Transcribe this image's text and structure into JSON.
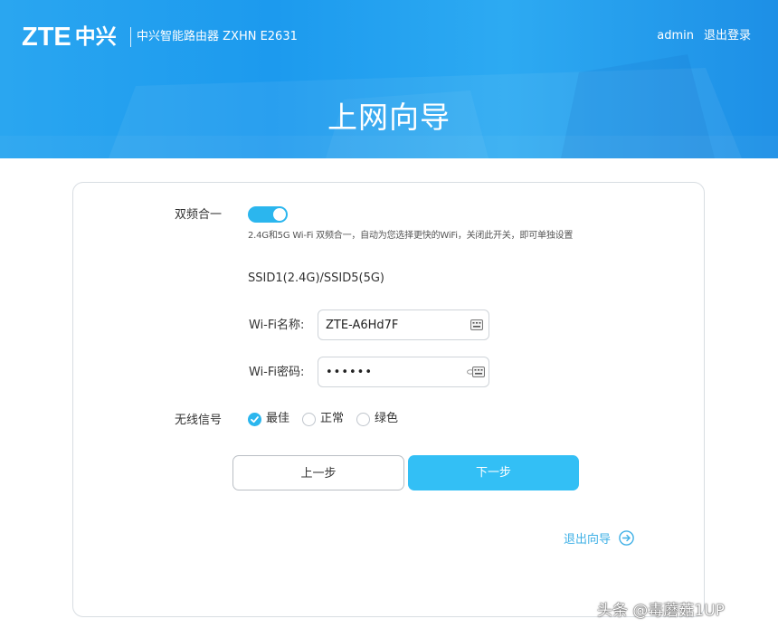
{
  "header": {
    "brand_latin": "ZTE",
    "brand_cn": "中兴",
    "product": "中兴智能路由器 ZXHN E2631",
    "user": "admin",
    "logout": "退出登录",
    "title": "上网向导"
  },
  "wizard": {
    "dual_band": {
      "label": "双频合一",
      "enabled": true,
      "hint": "2.4G和5G Wi-Fi 双频合一，自动为您选择更快的WiFi，关闭此开关，即可单独设置"
    },
    "ssid_title": "SSID1(2.4G)/SSID5(5G)",
    "wifi_name": {
      "label": "Wi-Fi名称:",
      "value": "ZTE-A6Hd7F"
    },
    "wifi_password": {
      "label": "Wi-Fi密码:",
      "value": "••••••"
    },
    "signal": {
      "label": "无线信号",
      "options": [
        {
          "label": "最佳",
          "checked": true
        },
        {
          "label": "正常",
          "checked": false
        },
        {
          "label": "绿色",
          "checked": false
        }
      ]
    },
    "buttons": {
      "prev": "上一步",
      "next": "下一步"
    },
    "exit_wizard": "退出向导"
  },
  "watermark": "头条 @毒蘑菇1UP",
  "colors": {
    "accent": "#33bff5",
    "header": "#1c9aee",
    "link": "#3fb0e6"
  }
}
